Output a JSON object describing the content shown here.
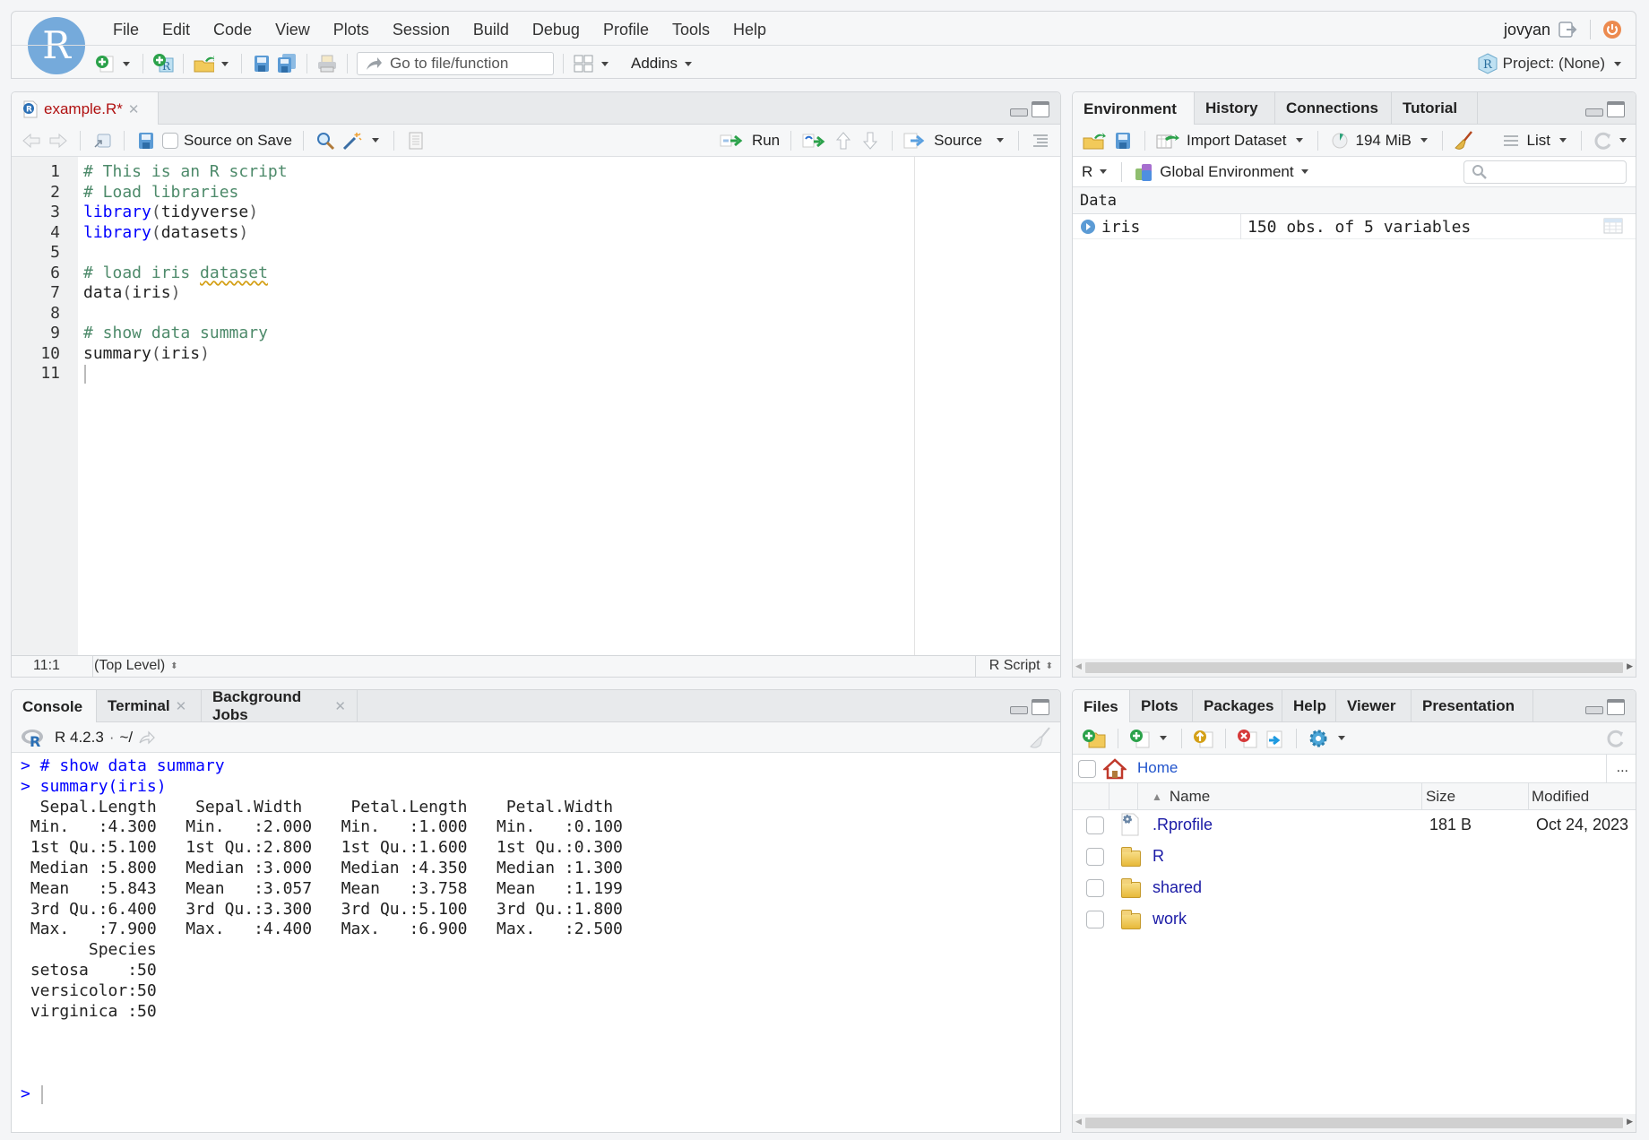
{
  "app": {
    "logo_letter": "R",
    "menu": [
      "File",
      "Edit",
      "Code",
      "View",
      "Plots",
      "Session",
      "Build",
      "Debug",
      "Profile",
      "Tools",
      "Help"
    ],
    "user": "jovyan",
    "toolbar": {
      "goto_placeholder": "Go to file/function",
      "addins_label": "Addins"
    },
    "project_label": "Project: (None)"
  },
  "source_pane": {
    "tab": {
      "label": "example.R*"
    },
    "source_on_save_label": "Source on Save",
    "source_on_save_checked": false,
    "run_label": "Run",
    "source_label": "Source",
    "code_lines": [
      {
        "n": "1",
        "segments": [
          {
            "t": "# This is an R script",
            "c": "cm"
          }
        ]
      },
      {
        "n": "2",
        "segments": [
          {
            "t": "# Load libraries",
            "c": "cm"
          }
        ]
      },
      {
        "n": "3",
        "segments": [
          {
            "t": "library",
            "c": "kw"
          },
          {
            "t": "(",
            "c": "pn"
          },
          {
            "t": "tidyverse",
            "c": ""
          },
          {
            "t": ")",
            "c": "pn"
          }
        ]
      },
      {
        "n": "4",
        "segments": [
          {
            "t": "library",
            "c": "kw"
          },
          {
            "t": "(",
            "c": "pn"
          },
          {
            "t": "datasets",
            "c": ""
          },
          {
            "t": ")",
            "c": "pn"
          }
        ]
      },
      {
        "n": "5",
        "segments": []
      },
      {
        "n": "6",
        "segments": [
          {
            "t": "# load iris ",
            "c": "cm"
          },
          {
            "t": "dataset",
            "c": "cm spell"
          }
        ]
      },
      {
        "n": "7",
        "segments": [
          {
            "t": "data",
            "c": ""
          },
          {
            "t": "(",
            "c": "pn"
          },
          {
            "t": "iris",
            "c": ""
          },
          {
            "t": ")",
            "c": "pn"
          }
        ]
      },
      {
        "n": "8",
        "segments": []
      },
      {
        "n": "9",
        "segments": [
          {
            "t": "# show data summary",
            "c": "cm"
          }
        ]
      },
      {
        "n": "10",
        "segments": [
          {
            "t": "summary",
            "c": ""
          },
          {
            "t": "(",
            "c": "pn"
          },
          {
            "t": "iris",
            "c": ""
          },
          {
            "t": ")",
            "c": "pn"
          }
        ]
      },
      {
        "n": "11",
        "segments": []
      }
    ],
    "status": {
      "cursor_pos": "11:1",
      "scope": "(Top Level)",
      "file_type": "R Script"
    }
  },
  "environment_pane": {
    "tabs": [
      "Environment",
      "History",
      "Connections",
      "Tutorial"
    ],
    "active_tab": "Environment",
    "import_dataset_label": "Import Dataset",
    "memory_label": "194 MiB",
    "view_mode_label": "List",
    "language_label": "R",
    "env_selector_label": "Global Environment",
    "search_placeholder": "",
    "section_header": "Data",
    "variables": [
      {
        "name": "iris",
        "value": "150 obs. of 5 variables"
      }
    ]
  },
  "console_pane": {
    "tabs": [
      "Console",
      "Terminal",
      "Background Jobs"
    ],
    "active_tab": "Console",
    "r_version": "R 4.2.3",
    "working_dir": "~/",
    "output_lines": [
      {
        "text": "> # show data summary",
        "cls": "blue"
      },
      {
        "text": "> summary(iris)",
        "cls": "blue"
      },
      {
        "text": "  Sepal.Length    Sepal.Width     Petal.Length    Petal.Width   ",
        "cls": ""
      },
      {
        "text": " Min.   :4.300   Min.   :2.000   Min.   :1.000   Min.   :0.100  ",
        "cls": ""
      },
      {
        "text": " 1st Qu.:5.100   1st Qu.:2.800   1st Qu.:1.600   1st Qu.:0.300  ",
        "cls": ""
      },
      {
        "text": " Median :5.800   Median :3.000   Median :4.350   Median :1.300  ",
        "cls": ""
      },
      {
        "text": " Mean   :5.843   Mean   :3.057   Mean   :3.758   Mean   :1.199  ",
        "cls": ""
      },
      {
        "text": " 3rd Qu.:6.400   3rd Qu.:3.300   3rd Qu.:5.100   3rd Qu.:1.800  ",
        "cls": ""
      },
      {
        "text": " Max.   :7.900   Max.   :4.400   Max.   :6.900   Max.   :2.500  ",
        "cls": ""
      },
      {
        "text": "       Species  ",
        "cls": ""
      },
      {
        "text": " setosa    :50  ",
        "cls": ""
      },
      {
        "text": " versicolor:50  ",
        "cls": ""
      },
      {
        "text": " virginica :50  ",
        "cls": ""
      }
    ],
    "prompt": ">"
  },
  "files_pane": {
    "tabs": [
      "Files",
      "Plots",
      "Packages",
      "Help",
      "Viewer",
      "Presentation"
    ],
    "active_tab": "Files",
    "breadcrumb": "Home",
    "more_label": "...",
    "columns": {
      "name": "Name",
      "size": "Size",
      "modified": "Modified"
    },
    "sort_indicator": "▲",
    "files": [
      {
        "name": ".Rprofile",
        "type": "file",
        "size": "181 B",
        "modified": "Oct 24, 2023"
      },
      {
        "name": "R",
        "type": "folder",
        "size": "",
        "modified": ""
      },
      {
        "name": "shared",
        "type": "folder",
        "size": "",
        "modified": ""
      },
      {
        "name": "work",
        "type": "folder",
        "size": "",
        "modified": ""
      }
    ]
  }
}
